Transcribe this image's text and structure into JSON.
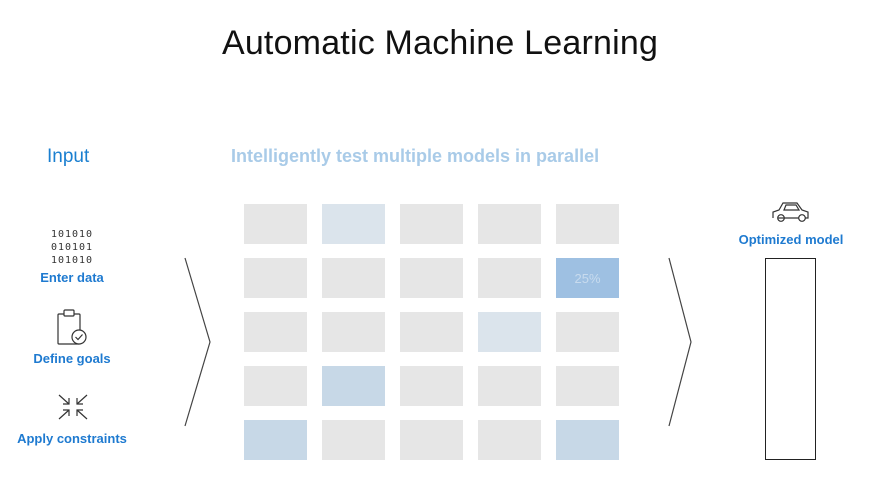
{
  "title": "Automatic Machine Learning",
  "input": {
    "heading": "Input",
    "steps": [
      {
        "label": "Enter data",
        "icon": "binary-data-icon",
        "binary": [
          "101010",
          "010101",
          "101010"
        ]
      },
      {
        "label": "Define goals",
        "icon": "clipboard-check-icon"
      },
      {
        "label": "Apply constraints",
        "icon": "compress-arrows-icon"
      }
    ]
  },
  "grid": {
    "heading": "Intelligently test multiple models in parallel",
    "cells": [
      [
        "plain",
        "light",
        "plain",
        "plain",
        "plain"
      ],
      [
        "plain",
        "plain",
        "plain",
        "plain",
        "strong"
      ],
      [
        "plain",
        "plain",
        "plain",
        "light",
        "plain"
      ],
      [
        "plain",
        "medium",
        "plain",
        "plain",
        "plain"
      ],
      [
        "medium",
        "plain",
        "plain",
        "plain",
        "medium"
      ]
    ],
    "progress_label": "25%"
  },
  "output": {
    "label": "Optimized model",
    "icon": "car-icon"
  },
  "colors": {
    "accent": "#1e7ad0",
    "cell": "#e6e6e6",
    "cell_highlight": "#9ec0e2"
  }
}
